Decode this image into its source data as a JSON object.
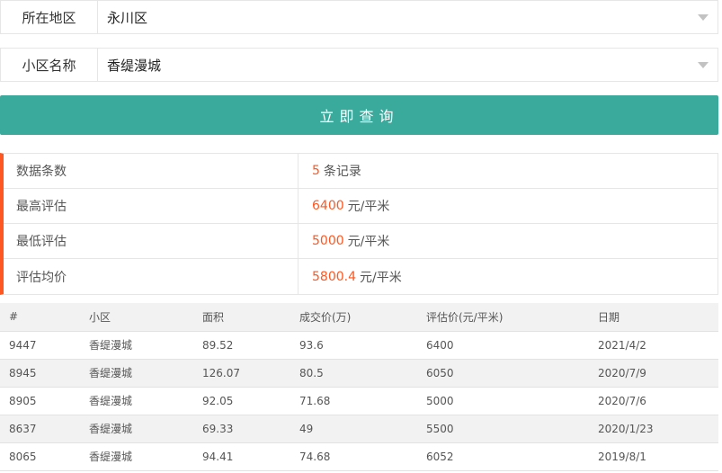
{
  "form": {
    "area_label": "所在地区",
    "area_value": "永川区",
    "community_label": "小区名称",
    "community_value": "香缇漫城",
    "query_button": "立即查询"
  },
  "stats": {
    "count_label": "数据条数",
    "count_value": "5",
    "count_unit": "条记录",
    "max_label": "最高评估",
    "max_value": "6400",
    "max_unit": "元/平米",
    "min_label": "最低评估",
    "min_value": "5000",
    "min_unit": "元/平米",
    "avg_label": "评估均价",
    "avg_value": "5800.4",
    "avg_unit": "元/平米"
  },
  "table": {
    "headers": [
      "#",
      "小区",
      "面积",
      "成交价(万)",
      "评估价(元/平米)",
      "日期"
    ],
    "rows": [
      [
        "9447",
        "香缇漫城",
        "89.52",
        "93.6",
        "6400",
        "2021/4/2"
      ],
      [
        "8945",
        "香缇漫城",
        "126.07",
        "80.5",
        "6050",
        "2020/7/9"
      ],
      [
        "8905",
        "香缇漫城",
        "92.05",
        "71.68",
        "5000",
        "2020/7/6"
      ],
      [
        "8637",
        "香缇漫城",
        "69.33",
        "49",
        "5500",
        "2020/1/23"
      ],
      [
        "8065",
        "香缇漫城",
        "94.41",
        "74.68",
        "6052",
        "2019/8/1"
      ]
    ]
  },
  "colors": {
    "accent": "#3aaa9d",
    "highlight": "#ff5722"
  }
}
